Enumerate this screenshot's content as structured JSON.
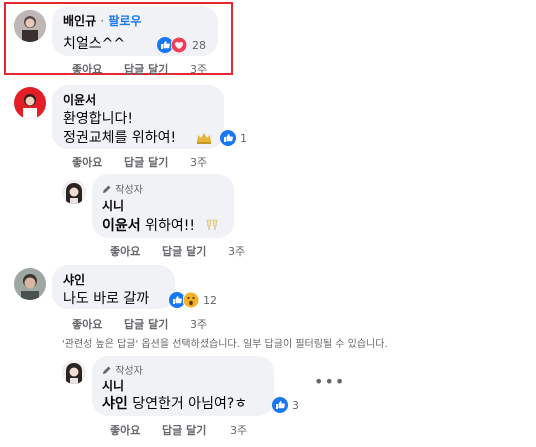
{
  "comments": [
    {
      "name": "배인규",
      "follow": "· 팔로우",
      "text": "치얼스^^",
      "reactions": "28",
      "actions": {
        "like": "좋아요",
        "reply": "답글 달기",
        "time": "3주"
      }
    },
    {
      "name": "이윤서",
      "line1": "환영합니다!",
      "line2": "정권교체를 위하여!",
      "reactions": "1",
      "actions": {
        "like": "좋아요",
        "reply": "답글 달기",
        "time": "3주"
      },
      "reply": {
        "author_label": "작성자",
        "name": "시니",
        "mention": "이윤서",
        "text": " 위하여!!",
        "actions": {
          "like": "좋아요",
          "reply": "답글 달기",
          "time": "3주"
        }
      }
    },
    {
      "name": "샤인",
      "text": "나도 바로 갈까",
      "reactions": "12",
      "actions": {
        "like": "좋아요",
        "reply": "답글 달기",
        "time": "3주"
      },
      "notice": "'관련성 높은 답글' 옵션을 선택하셨습니다. 일부 답글이 필터링될 수 있습니다.",
      "reply": {
        "author_label": "작성자",
        "name": "시니",
        "mention": "샤인",
        "text": " 당연한거 아님여?ㅎ",
        "reactions": "3",
        "actions": {
          "like": "좋아요",
          "reply": "답글 달기",
          "time": "3주"
        }
      }
    }
  ],
  "colors": {
    "highlight": "#e8262e",
    "like": "#1877f2",
    "love": "#f33e58",
    "bubble": "#f0f2f5"
  },
  "icons": [
    "like-icon",
    "love-icon",
    "haha-icon",
    "wow-icon",
    "crown-emoji-icon",
    "cheers-emoji-icon",
    "pencil-icon",
    "more-options-icon"
  ]
}
